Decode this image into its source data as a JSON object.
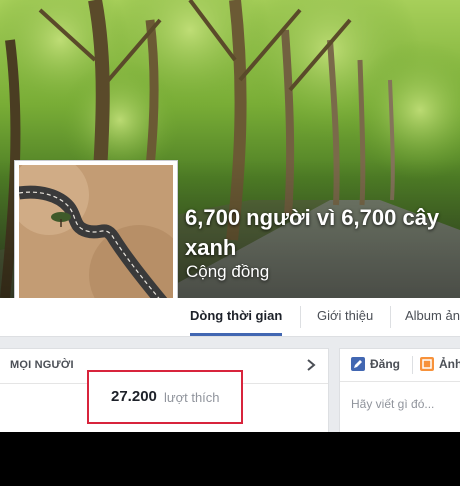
{
  "page": {
    "name": "6,700 người vì 6,700 cây xanh",
    "category": "Cộng đồng"
  },
  "tabs": [
    {
      "label": "Dòng thời gian",
      "active": true
    },
    {
      "label": "Giới thiệu",
      "active": false
    },
    {
      "label": "Album ảnh",
      "active": false
    }
  ],
  "people": {
    "title": "MỌI NGƯỜI",
    "likes_count": "27.200",
    "likes_label": "lượt thích"
  },
  "composer": {
    "post_label": "Đăng",
    "photo_label": "Ảnh",
    "placeholder": "Hãy viết gì đó..."
  },
  "colors": {
    "accent": "#4267b2",
    "highlight_border": "#d8243c",
    "background": "#e9ebee"
  }
}
